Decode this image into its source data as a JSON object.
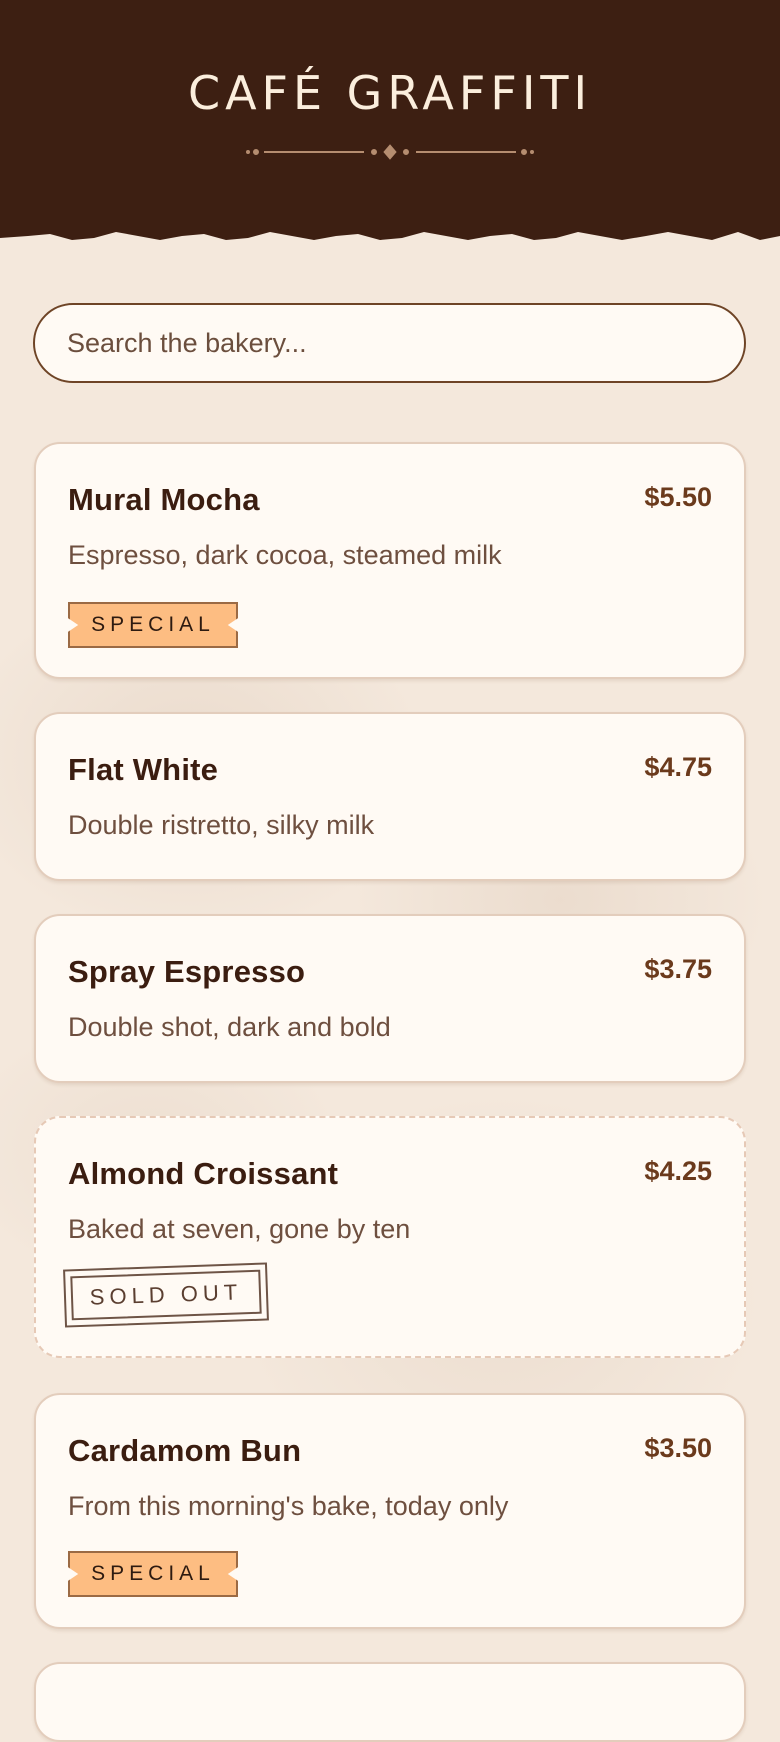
{
  "header": {
    "title": "CAFÉ GRAFFITI"
  },
  "search": {
    "placeholder": "Search the bakery..."
  },
  "menu": [
    {
      "name": "Mural Mocha",
      "price": "$5.50",
      "description": "Espresso, dark cocoa, steamed milk",
      "badge": "SPECIAL"
    },
    {
      "name": "Flat White",
      "price": "$4.75",
      "description": "Double ristretto, silky milk"
    },
    {
      "name": "Spray Espresso",
      "price": "$3.75",
      "description": "Double shot, dark and bold"
    },
    {
      "name": "Almond Croissant",
      "price": "$4.25",
      "description": "Baked at seven, gone by ten",
      "status": "SOLD OUT"
    },
    {
      "name": "Cardamom Bun",
      "price": "$3.50",
      "description": "From this morning's bake, today only",
      "badge": "SPECIAL"
    }
  ],
  "colors": {
    "header_bg": "#3d1f12",
    "accent": "#fdbd82",
    "card_bg": "#fffaf4",
    "page_bg": "#f4e8dc"
  }
}
